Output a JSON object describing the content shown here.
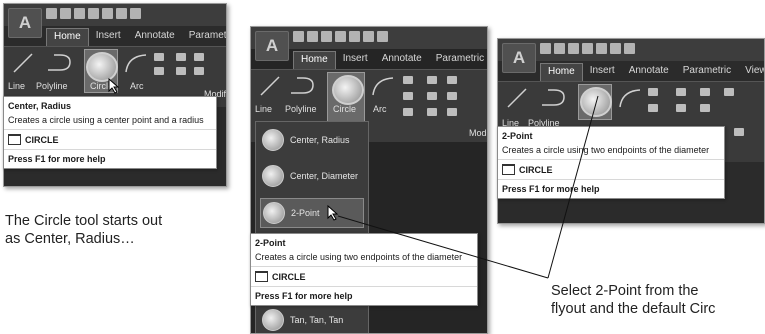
{
  "logo_letter": "A",
  "tabs": [
    "Home",
    "Insert",
    "Annotate",
    "Parametric",
    "View"
  ],
  "tools": {
    "line": "Line",
    "polyline": "Polyline",
    "circle": "Circle",
    "arc": "Arc",
    "modify": "Modify"
  },
  "tooltip1": {
    "title": "Center, Radius",
    "desc": "Creates a circle using a center point and a radius",
    "command": "CIRCLE",
    "help": "Press F1 for more help"
  },
  "tooltip2": {
    "title": "2-Point",
    "desc": "Creates a circle using two endpoints of the diameter",
    "command": "CIRCLE",
    "help": "Press F1 for more help"
  },
  "tooltip3": {
    "title": "2-Point",
    "desc": "Creates a circle using two endpoints of the diameter",
    "command": "CIRCLE",
    "help": "Press F1 for more help"
  },
  "flyout": [
    "Center, Radius",
    "Center, Diameter",
    "2-Point",
    "Tan, Tan, Tan"
  ],
  "caption_left": [
    "The Circle tool starts out",
    "as Center, Radius…"
  ],
  "caption_right": [
    "Select 2-Point from the",
    "flyout and the default Circ"
  ]
}
